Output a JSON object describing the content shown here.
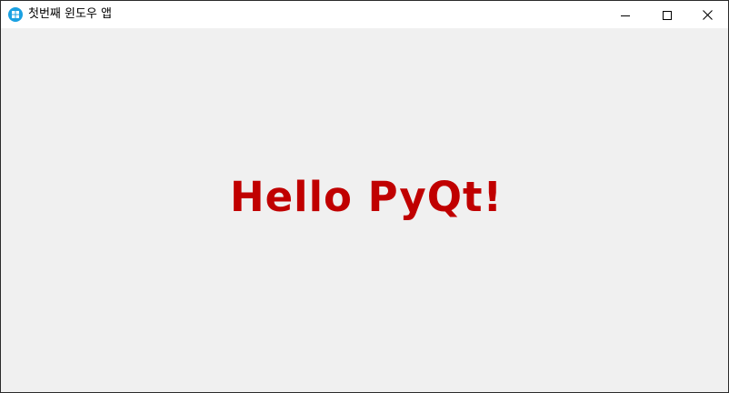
{
  "window": {
    "title": "첫번째 윈도우 앱",
    "app_icon": "app-logo-icon",
    "controls": {
      "minimize_icon": "minimize-icon",
      "maximize_icon": "maximize-icon",
      "close_icon": "close-icon"
    }
  },
  "content": {
    "label_text": "Hello PyQt!",
    "label_color": "#c00000"
  },
  "colors": {
    "titlebar_bg": "#ffffff",
    "client_bg": "#f0f0f0",
    "app_icon_color": "#1ba1e2"
  }
}
